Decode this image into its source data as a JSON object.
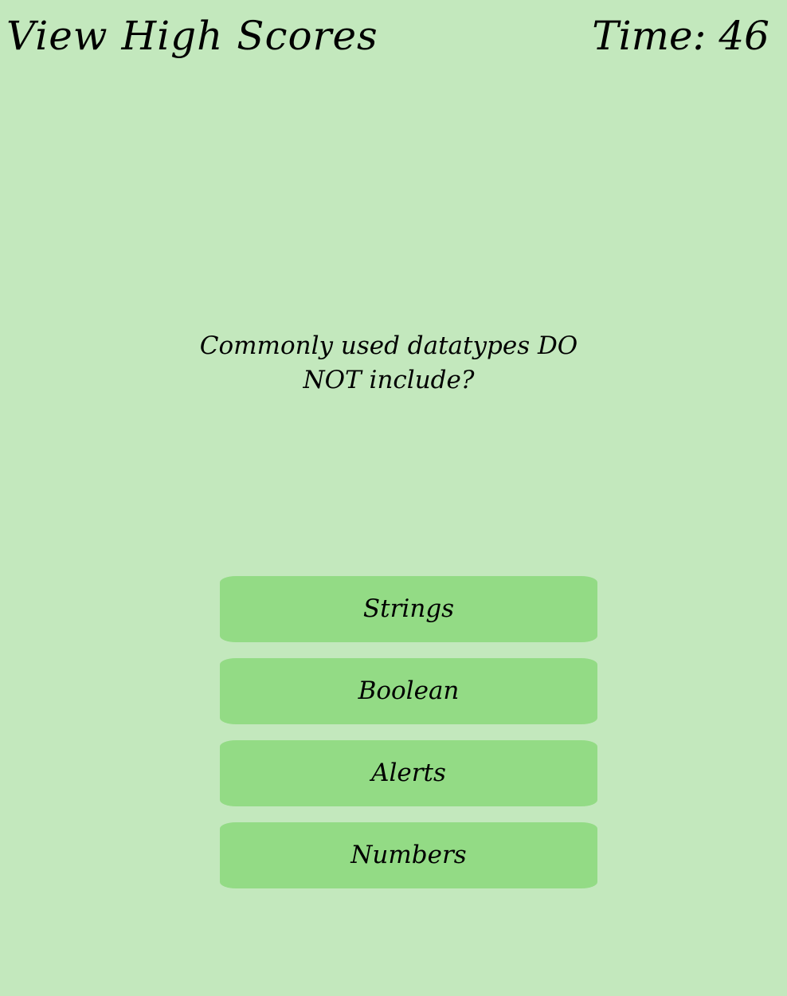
{
  "header": {
    "high_scores_label": "View High Scores",
    "timer_label": "Time:",
    "timer_value": "46"
  },
  "quiz": {
    "question": "Commonly used datatypes DO NOT include?",
    "answers": [
      {
        "label": "Strings"
      },
      {
        "label": "Boolean"
      },
      {
        "label": "Alerts"
      },
      {
        "label": "Numbers"
      }
    ]
  },
  "colors": {
    "background": "#c3e8bd",
    "answer_button": "#93db85",
    "text": "#000000"
  }
}
